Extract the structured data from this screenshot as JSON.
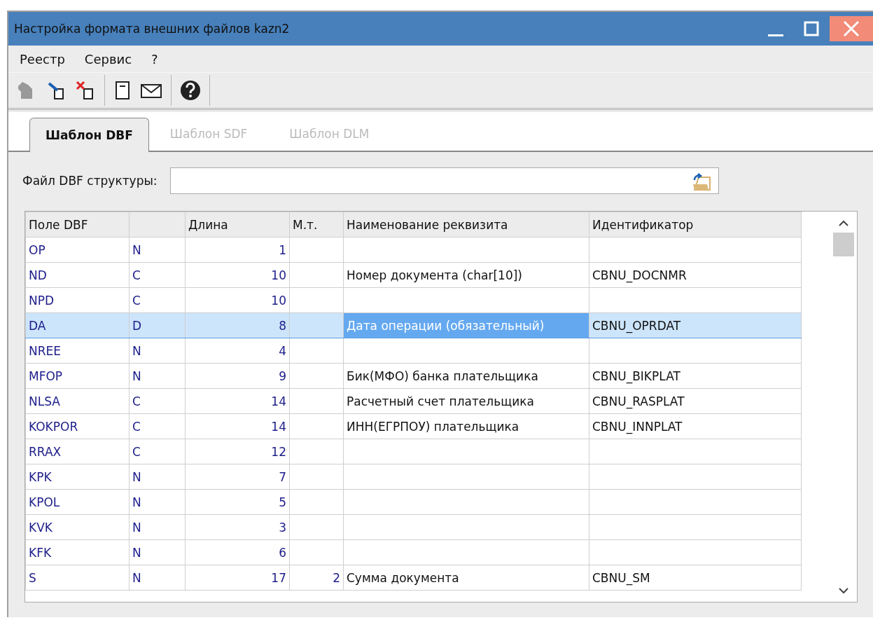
{
  "window": {
    "title": "Настройка формата внешних файлов kazn2"
  },
  "menu": [
    "Реестр",
    "Сервис",
    "?"
  ],
  "tabs": [
    {
      "label": "Шаблон DBF",
      "selected": true
    },
    {
      "label": "Шаблон SDF",
      "selected": false
    },
    {
      "label": "Шаблон DLM",
      "selected": false
    }
  ],
  "file_field": {
    "label": "Файл DBF структуры:"
  },
  "table": {
    "columns": [
      "Поле DBF",
      "",
      "Длина",
      "М.т.",
      "Наименование реквизита",
      "Идентификатор"
    ],
    "rows": [
      {
        "cells": [
          "OP",
          "N",
          "1",
          "",
          "",
          ""
        ],
        "selected": false
      },
      {
        "cells": [
          "ND",
          "C",
          "10",
          "",
          "Номер документа (char[10])",
          "CBNU_DOCNMR"
        ],
        "selected": false
      },
      {
        "cells": [
          "NPD",
          "C",
          "10",
          "",
          "",
          ""
        ],
        "selected": false
      },
      {
        "cells": [
          "DA",
          "D",
          "8",
          "",
          "Дата операции (обязательный)",
          "CBNU_OPRDAT"
        ],
        "selected": true
      },
      {
        "cells": [
          "NREE",
          "N",
          "4",
          "",
          "",
          ""
        ],
        "selected": false
      },
      {
        "cells": [
          "MFOP",
          "N",
          "9",
          "",
          "Бик(МФО) банка плательщика",
          "CBNU_BIKPLAT"
        ],
        "selected": false
      },
      {
        "cells": [
          "NLSA",
          "C",
          "14",
          "",
          "Расчетный счет плательщика",
          "CBNU_RASPLAT"
        ],
        "selected": false
      },
      {
        "cells": [
          "KOKPOR",
          "C",
          "14",
          "",
          "ИНН(ЕГРПОУ) плательщика",
          "CBNU_INNPLAT"
        ],
        "selected": false
      },
      {
        "cells": [
          "RRAX",
          "C",
          "12",
          "",
          "",
          ""
        ],
        "selected": false
      },
      {
        "cells": [
          "KPK",
          "N",
          "7",
          "",
          "",
          ""
        ],
        "selected": false
      },
      {
        "cells": [
          "KPOL",
          "N",
          "5",
          "",
          "",
          ""
        ],
        "selected": false
      },
      {
        "cells": [
          "KVK",
          "N",
          "3",
          "",
          "",
          ""
        ],
        "selected": false
      },
      {
        "cells": [
          "KFK",
          "N",
          "6",
          "",
          "",
          ""
        ],
        "selected": false
      },
      {
        "cells": [
          "S",
          "N",
          "17",
          "2",
          "Сумма документа",
          "CBNU_SM"
        ],
        "selected": false
      }
    ]
  }
}
